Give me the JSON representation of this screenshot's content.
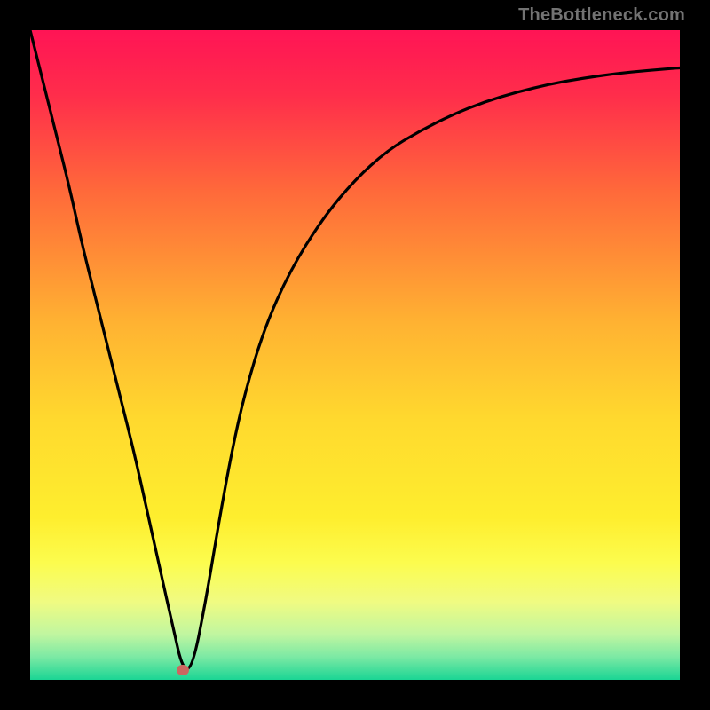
{
  "watermark": "TheBottleneck.com",
  "chart_data": {
    "type": "line",
    "title": "",
    "xlabel": "",
    "ylabel": "",
    "xlim": [
      0,
      100
    ],
    "ylim": [
      0,
      100
    ],
    "grid": false,
    "legend": false,
    "background": {
      "type": "vertical-gradient",
      "stops": [
        {
          "pos": 0.0,
          "color": "#ff1455"
        },
        {
          "pos": 0.1,
          "color": "#ff2d4b"
        },
        {
          "pos": 0.25,
          "color": "#ff6a3a"
        },
        {
          "pos": 0.45,
          "color": "#ffb232"
        },
        {
          "pos": 0.6,
          "color": "#ffd92e"
        },
        {
          "pos": 0.75,
          "color": "#feee2e"
        },
        {
          "pos": 0.82,
          "color": "#fcfc4e"
        },
        {
          "pos": 0.88,
          "color": "#f0fb82"
        },
        {
          "pos": 0.93,
          "color": "#c0f6a0"
        },
        {
          "pos": 0.965,
          "color": "#7be9a4"
        },
        {
          "pos": 1.0,
          "color": "#1ad594"
        }
      ]
    },
    "series": [
      {
        "name": "bottleneck-curve",
        "color": "#000000",
        "x": [
          0,
          2,
          4,
          6,
          8,
          10,
          12,
          14,
          16,
          18,
          20,
          22,
          23.5,
          25,
          27,
          29,
          31,
          33,
          36,
          40,
          45,
          50,
          55,
          60,
          65,
          70,
          75,
          80,
          85,
          90,
          95,
          100
        ],
        "y": [
          100,
          92,
          84,
          76,
          67,
          59,
          51,
          43,
          35,
          26,
          17,
          8,
          1.5,
          2,
          12,
          24,
          35,
          44,
          54,
          63,
          71,
          77,
          81.5,
          84.5,
          87,
          89,
          90.5,
          91.7,
          92.6,
          93.3,
          93.8,
          94.2
        ]
      }
    ],
    "markers": [
      {
        "name": "optimal-point",
        "x": 23.5,
        "y": 1.5,
        "color": "#cc6660"
      }
    ]
  }
}
